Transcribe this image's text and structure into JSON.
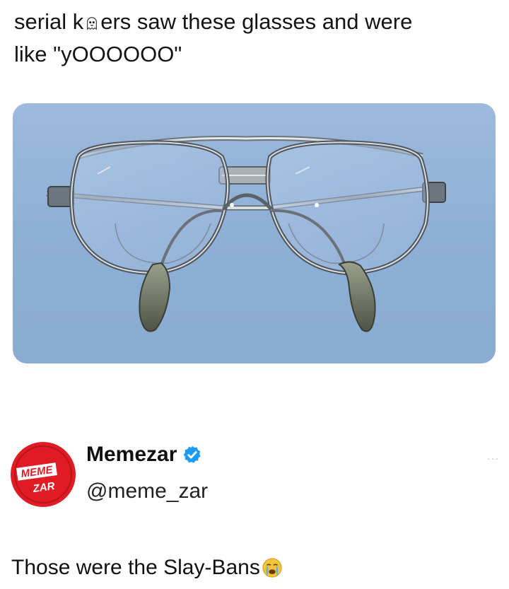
{
  "caption": {
    "line1_before": "serial k",
    "line1_emoji": "ghost-icon",
    "line1_after": "ers saw these glasses and were",
    "line2": "like \"yOOOOOO\""
  },
  "image": {
    "subject": "glasses-image",
    "background_color": "#96b4d9"
  },
  "post": {
    "avatar_text_top": "MEME",
    "avatar_text_bottom": "ZAR",
    "display_name": "Memezar",
    "handle": "@meme_zar",
    "more_label": "···",
    "text": "Those were the Slay-Bans",
    "text_emoji": "crying-face-icon",
    "verified_color": "#1d9bf0",
    "avatar_color": "#e01b24"
  }
}
